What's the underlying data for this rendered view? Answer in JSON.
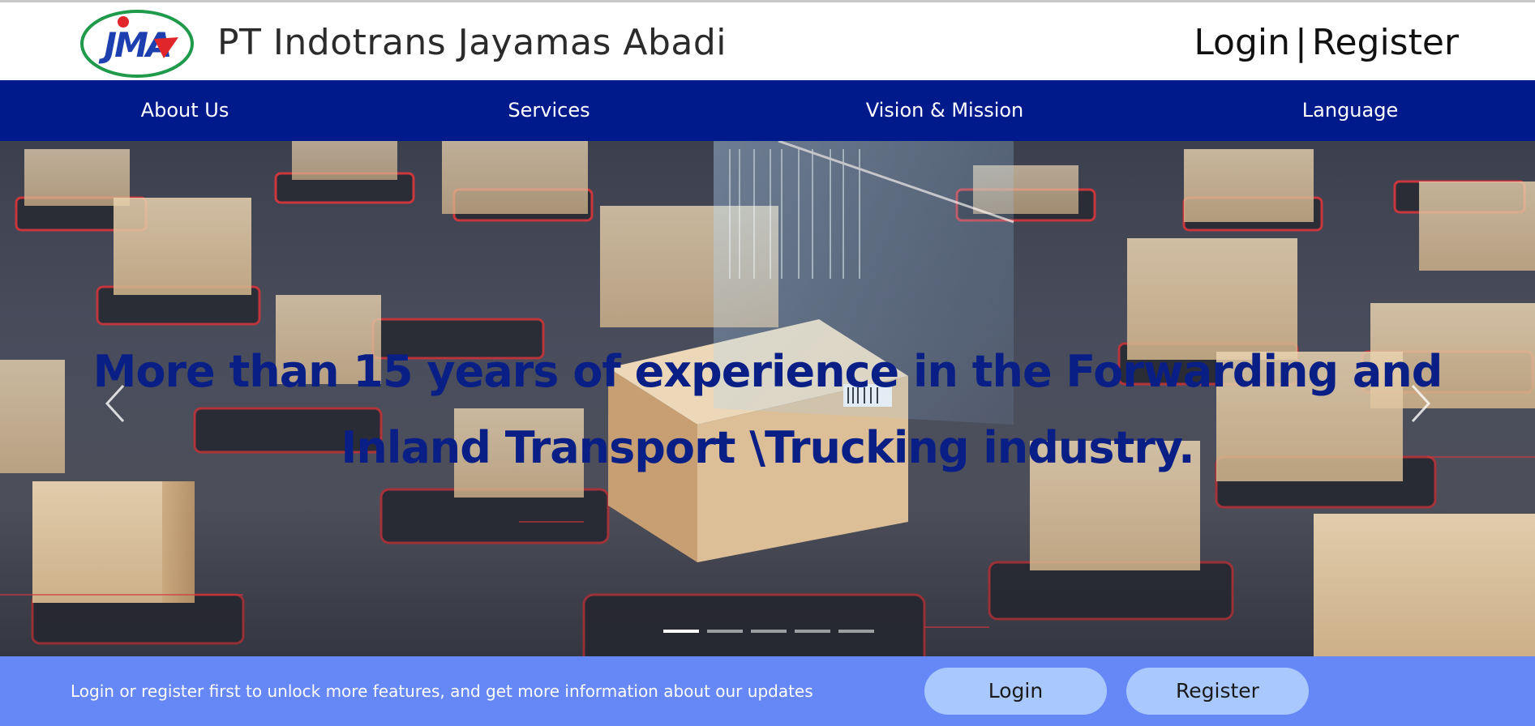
{
  "header": {
    "company_name": "PT Indotrans Jayamas Abadi",
    "logo_text": "JMA",
    "login_link": "Login",
    "separator": "|",
    "register_link": "Register"
  },
  "nav": {
    "items": [
      {
        "label": "About Us"
      },
      {
        "label": "Services"
      },
      {
        "label": "Vision & Mission"
      },
      {
        "label": "Language"
      }
    ]
  },
  "hero": {
    "headline_line1": "More than 15 years of experience in the Forwarding and",
    "headline_line2": "Inland Transport \\Trucking industry.",
    "slide_count": 5,
    "active_slide": 1,
    "prev_icon": "chevron-left-icon",
    "next_icon": "chevron-right-icon"
  },
  "footer": {
    "message": "Login or register first to unlock more features, and get more information about our updates",
    "login_button": "Login",
    "register_button": "Register"
  },
  "colors": {
    "nav_bg": "#001a8c",
    "headline": "#0a1f86",
    "footer_bg": "#6688f7",
    "button_bg": "#a9c8fd",
    "logo_ring": "#1f9a4a",
    "logo_blue": "#1d3fb0",
    "logo_red": "#e0262b"
  }
}
